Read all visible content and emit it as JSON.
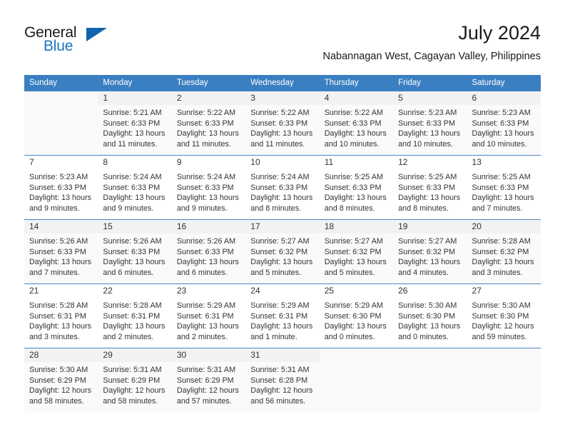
{
  "brand": {
    "name_top": "General",
    "name_bottom": "Blue",
    "accent_color": "#1064ad",
    "text_color": "#1a1a1a"
  },
  "header": {
    "title": "July 2024",
    "subtitle": "Nabannagan West, Cagayan Valley, Philippines"
  },
  "calendar": {
    "header_bg": "#3a7fc1",
    "header_text_color": "#ffffff",
    "weekdays": [
      "Sunday",
      "Monday",
      "Tuesday",
      "Wednesday",
      "Thursday",
      "Friday",
      "Saturday"
    ],
    "weeks": [
      [
        {
          "day": "",
          "lines": []
        },
        {
          "day": "1",
          "lines": [
            "Sunrise: 5:21 AM",
            "Sunset: 6:33 PM",
            "Daylight: 13 hours",
            "and 11 minutes."
          ]
        },
        {
          "day": "2",
          "lines": [
            "Sunrise: 5:22 AM",
            "Sunset: 6:33 PM",
            "Daylight: 13 hours",
            "and 11 minutes."
          ]
        },
        {
          "day": "3",
          "lines": [
            "Sunrise: 5:22 AM",
            "Sunset: 6:33 PM",
            "Daylight: 13 hours",
            "and 11 minutes."
          ]
        },
        {
          "day": "4",
          "lines": [
            "Sunrise: 5:22 AM",
            "Sunset: 6:33 PM",
            "Daylight: 13 hours",
            "and 10 minutes."
          ]
        },
        {
          "day": "5",
          "lines": [
            "Sunrise: 5:23 AM",
            "Sunset: 6:33 PM",
            "Daylight: 13 hours",
            "and 10 minutes."
          ]
        },
        {
          "day": "6",
          "lines": [
            "Sunrise: 5:23 AM",
            "Sunset: 6:33 PM",
            "Daylight: 13 hours",
            "and 10 minutes."
          ]
        }
      ],
      [
        {
          "day": "7",
          "lines": [
            "Sunrise: 5:23 AM",
            "Sunset: 6:33 PM",
            "Daylight: 13 hours",
            "and 9 minutes."
          ]
        },
        {
          "day": "8",
          "lines": [
            "Sunrise: 5:24 AM",
            "Sunset: 6:33 PM",
            "Daylight: 13 hours",
            "and 9 minutes."
          ]
        },
        {
          "day": "9",
          "lines": [
            "Sunrise: 5:24 AM",
            "Sunset: 6:33 PM",
            "Daylight: 13 hours",
            "and 9 minutes."
          ]
        },
        {
          "day": "10",
          "lines": [
            "Sunrise: 5:24 AM",
            "Sunset: 6:33 PM",
            "Daylight: 13 hours",
            "and 8 minutes."
          ]
        },
        {
          "day": "11",
          "lines": [
            "Sunrise: 5:25 AM",
            "Sunset: 6:33 PM",
            "Daylight: 13 hours",
            "and 8 minutes."
          ]
        },
        {
          "day": "12",
          "lines": [
            "Sunrise: 5:25 AM",
            "Sunset: 6:33 PM",
            "Daylight: 13 hours",
            "and 8 minutes."
          ]
        },
        {
          "day": "13",
          "lines": [
            "Sunrise: 5:25 AM",
            "Sunset: 6:33 PM",
            "Daylight: 13 hours",
            "and 7 minutes."
          ]
        }
      ],
      [
        {
          "day": "14",
          "lines": [
            "Sunrise: 5:26 AM",
            "Sunset: 6:33 PM",
            "Daylight: 13 hours",
            "and 7 minutes."
          ]
        },
        {
          "day": "15",
          "lines": [
            "Sunrise: 5:26 AM",
            "Sunset: 6:33 PM",
            "Daylight: 13 hours",
            "and 6 minutes."
          ]
        },
        {
          "day": "16",
          "lines": [
            "Sunrise: 5:26 AM",
            "Sunset: 6:33 PM",
            "Daylight: 13 hours",
            "and 6 minutes."
          ]
        },
        {
          "day": "17",
          "lines": [
            "Sunrise: 5:27 AM",
            "Sunset: 6:32 PM",
            "Daylight: 13 hours",
            "and 5 minutes."
          ]
        },
        {
          "day": "18",
          "lines": [
            "Sunrise: 5:27 AM",
            "Sunset: 6:32 PM",
            "Daylight: 13 hours",
            "and 5 minutes."
          ]
        },
        {
          "day": "19",
          "lines": [
            "Sunrise: 5:27 AM",
            "Sunset: 6:32 PM",
            "Daylight: 13 hours",
            "and 4 minutes."
          ]
        },
        {
          "day": "20",
          "lines": [
            "Sunrise: 5:28 AM",
            "Sunset: 6:32 PM",
            "Daylight: 13 hours",
            "and 3 minutes."
          ]
        }
      ],
      [
        {
          "day": "21",
          "lines": [
            "Sunrise: 5:28 AM",
            "Sunset: 6:31 PM",
            "Daylight: 13 hours",
            "and 3 minutes."
          ]
        },
        {
          "day": "22",
          "lines": [
            "Sunrise: 5:28 AM",
            "Sunset: 6:31 PM",
            "Daylight: 13 hours",
            "and 2 minutes."
          ]
        },
        {
          "day": "23",
          "lines": [
            "Sunrise: 5:29 AM",
            "Sunset: 6:31 PM",
            "Daylight: 13 hours",
            "and 2 minutes."
          ]
        },
        {
          "day": "24",
          "lines": [
            "Sunrise: 5:29 AM",
            "Sunset: 6:31 PM",
            "Daylight: 13 hours",
            "and 1 minute."
          ]
        },
        {
          "day": "25",
          "lines": [
            "Sunrise: 5:29 AM",
            "Sunset: 6:30 PM",
            "Daylight: 13 hours",
            "and 0 minutes."
          ]
        },
        {
          "day": "26",
          "lines": [
            "Sunrise: 5:30 AM",
            "Sunset: 6:30 PM",
            "Daylight: 13 hours",
            "and 0 minutes."
          ]
        },
        {
          "day": "27",
          "lines": [
            "Sunrise: 5:30 AM",
            "Sunset: 6:30 PM",
            "Daylight: 12 hours",
            "and 59 minutes."
          ]
        }
      ],
      [
        {
          "day": "28",
          "lines": [
            "Sunrise: 5:30 AM",
            "Sunset: 6:29 PM",
            "Daylight: 12 hours",
            "and 58 minutes."
          ]
        },
        {
          "day": "29",
          "lines": [
            "Sunrise: 5:31 AM",
            "Sunset: 6:29 PM",
            "Daylight: 12 hours",
            "and 58 minutes."
          ]
        },
        {
          "day": "30",
          "lines": [
            "Sunrise: 5:31 AM",
            "Sunset: 6:29 PM",
            "Daylight: 12 hours",
            "and 57 minutes."
          ]
        },
        {
          "day": "31",
          "lines": [
            "Sunrise: 5:31 AM",
            "Sunset: 6:28 PM",
            "Daylight: 12 hours",
            "and 56 minutes."
          ]
        },
        {
          "day": "",
          "lines": []
        },
        {
          "day": "",
          "lines": []
        },
        {
          "day": "",
          "lines": []
        }
      ]
    ]
  }
}
